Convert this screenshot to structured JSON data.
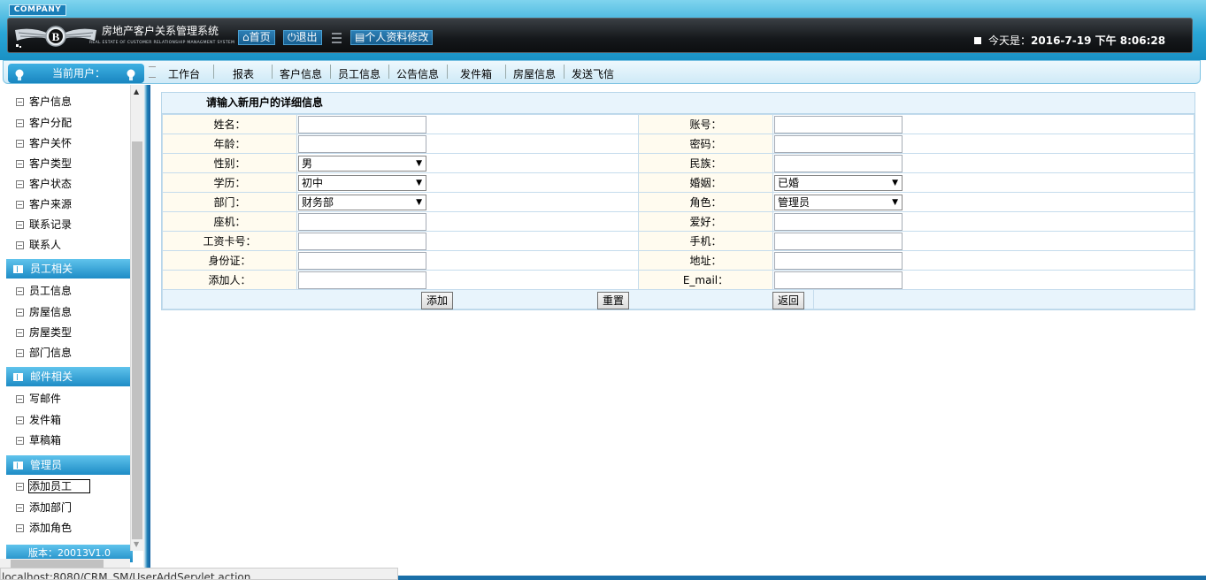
{
  "header": {
    "company": "COMPANY",
    "system_title": "房地产客户关系管理系统",
    "system_subtitle": "REAL ESTATE OF CUSTOMER RELATIONSHIP MANAGMENT SYSTEM",
    "home_label": "首页",
    "exit_label": "退出",
    "profile_label": "个人资料修改",
    "today_prefix": "今天是：",
    "today_value": "2016-7-19 下午 8:06:28"
  },
  "nav": {
    "current_user_label": "当前用户：",
    "items": [
      "工作台",
      "报表",
      "客户信息",
      "员工信息",
      "公告信息",
      "发件箱",
      "房屋信息",
      "发送飞信"
    ]
  },
  "sidebar": {
    "customer_items": [
      "客户信息",
      "客户分配",
      "客户关怀",
      "客户类型",
      "客户状态",
      "客户来源",
      "联系记录",
      "联系人"
    ],
    "employee_title": "员工相关",
    "employee_items": [
      "员工信息",
      "房屋信息",
      "房屋类型",
      "部门信息"
    ],
    "mail_title": "邮件相关",
    "mail_items": [
      "写邮件",
      "发件箱",
      "草稿箱"
    ],
    "admin_title": "管理员",
    "admin_items": [
      "添加员工",
      "添加部门",
      "添加角色"
    ],
    "version": "版本：20013V1.0"
  },
  "form": {
    "title": "请输入新用户的详细信息",
    "labels": {
      "name": "姓名：",
      "account": "账号：",
      "age": "年龄：",
      "password": "密码：",
      "gender": "性别：",
      "ethnicity": "民族：",
      "education": "学历：",
      "marriage": "婚姻：",
      "department": "部门：",
      "role": "角色：",
      "landline": "座机：",
      "hobby": "爱好：",
      "salary_card": "工资卡号：",
      "mobile": "手机：",
      "id_card": "身份证：",
      "address": "地址：",
      "added_by": "添加人：",
      "email": "E_mail："
    },
    "selects": {
      "gender": "男",
      "education": "初中",
      "marriage": "已婚",
      "department": "财务部",
      "role": "管理员"
    },
    "buttons": {
      "add": "添加",
      "reset": "重置",
      "back": "返回"
    }
  },
  "status_bar": {
    "url": "localhost:8080/CRM_SM/UserAddServlet.action"
  },
  "colors": {
    "header_blue": "#2aa6d6",
    "dark_bar": "#15181b",
    "label_bg": "#fffbef",
    "form_border": "#c5dced"
  }
}
